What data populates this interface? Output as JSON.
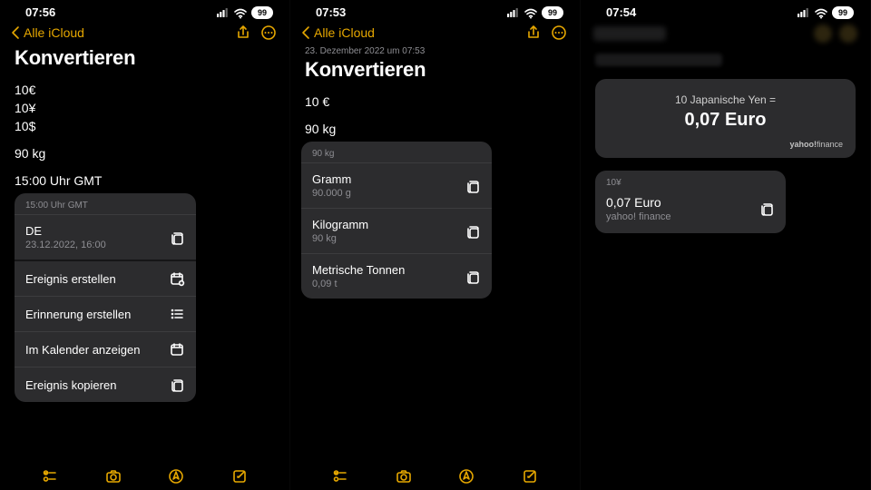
{
  "panels": [
    {
      "time": "07:56",
      "battery": "99",
      "back_label": "Alle iCloud",
      "title": "Konvertieren",
      "lines": [
        "10€",
        "10¥",
        "10$",
        "",
        "90 kg",
        "",
        "15:00 Uhr GMT"
      ],
      "popup": {
        "header": "15:00 Uhr GMT",
        "sections": [
          [
            {
              "primary": "DE",
              "secondary": "23.12.2022, 16:00",
              "icon": "copy"
            }
          ],
          [
            {
              "primary": "Ereignis erstellen",
              "icon": "calendar-add"
            },
            {
              "primary": "Erinnerung erstellen",
              "icon": "list"
            },
            {
              "primary": "Im Kalender anzeigen",
              "icon": "calendar"
            },
            {
              "primary": "Ereignis kopieren",
              "icon": "copy"
            }
          ]
        ]
      }
    },
    {
      "time": "07:53",
      "battery": "99",
      "back_label": "Alle iCloud",
      "timestamp": "23. Dezember 2022 um 07:53",
      "title": "Konvertieren",
      "lines": [
        "10 €",
        "",
        "90 kg"
      ],
      "popup": {
        "header": "90 kg",
        "sections": [
          [
            {
              "primary": "Gramm",
              "secondary": "90.000 g",
              "icon": "copy"
            },
            {
              "primary": "Kilogramm",
              "secondary": "90 kg",
              "icon": "copy"
            },
            {
              "primary": "Metrische Tonnen",
              "secondary": "0,09 t",
              "icon": "copy"
            }
          ]
        ]
      }
    },
    {
      "time": "07:54",
      "battery": "99",
      "big_card": {
        "line1": "10 Japanische Yen =",
        "line2": "0,07 Euro",
        "attr_bold": "yahoo!",
        "attr_rest": "finance"
      },
      "small_card": {
        "header": "10¥",
        "primary": "0,07 Euro",
        "secondary": "yahoo! finance"
      }
    }
  ]
}
